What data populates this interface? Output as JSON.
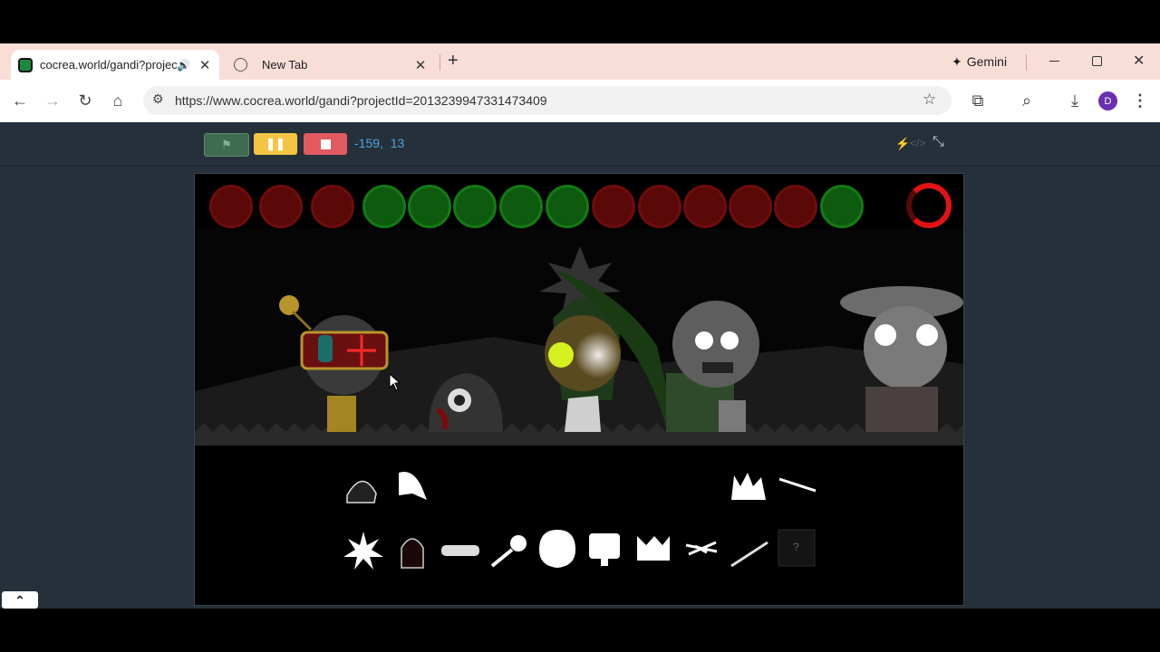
{
  "browser": {
    "tabs": [
      {
        "title": "cocrea.world/gandi?projectI",
        "active": true
      },
      {
        "title": "New Tab",
        "active": false
      }
    ],
    "new_tab_label": "+",
    "gemini_label": "Gemini",
    "url": "https://www.cocrea.world/gandi?projectId=2013239947331473409",
    "profile_initial": "D",
    "accent_color": "#f9ded8"
  },
  "player": {
    "coordinates": "-159,  13",
    "green_flag_icon": "flag-icon",
    "pause_icon": "pause-icon",
    "stop_icon": "stop-icon"
  },
  "stage": {
    "top_icons": [
      {
        "name": "red-icon-1",
        "color": "red"
      },
      {
        "name": "red-icon-2",
        "color": "red"
      },
      {
        "name": "red-icon-3",
        "color": "red"
      },
      {
        "name": "green-icon-1",
        "color": "green"
      },
      {
        "name": "green-icon-2",
        "color": "green"
      },
      {
        "name": "green-icon-3",
        "color": "green"
      },
      {
        "name": "green-icon-4",
        "color": "green"
      },
      {
        "name": "green-icon-5",
        "color": "green"
      },
      {
        "name": "red-icon-4",
        "color": "red"
      },
      {
        "name": "red-icon-5",
        "color": "red"
      },
      {
        "name": "red-icon-6",
        "color": "red"
      },
      {
        "name": "red-icon-7",
        "color": "red"
      },
      {
        "name": "red-icon-8",
        "color": "red"
      },
      {
        "name": "green-icon-6",
        "color": "green"
      }
    ],
    "bottom_item_mystery": "?"
  },
  "expand_icon": "chevron-up-icon"
}
